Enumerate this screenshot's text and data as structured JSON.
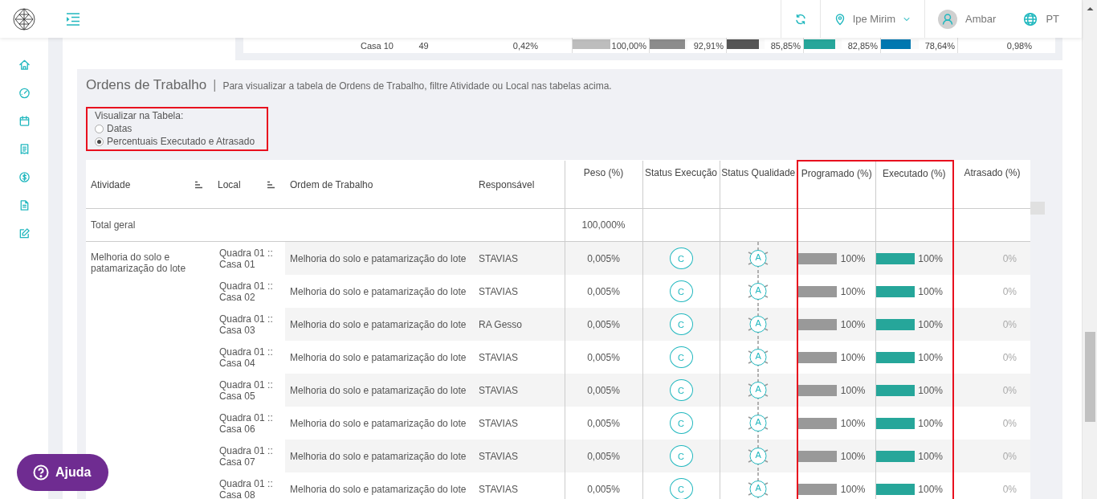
{
  "header": {
    "location": "Ipe Mirim",
    "user": "Ambar",
    "language": "PT"
  },
  "summary_row": {
    "local": "Casa 10",
    "count": "49",
    "share": "0,42%",
    "bars": [
      {
        "value": "100,00%",
        "level": 1,
        "color": "#bdbdbd"
      },
      {
        "value": "92,91%",
        "level": 0.93,
        "color": "#8c8c8c"
      },
      {
        "value": "85,85%",
        "level": 0.86,
        "color": "#555555"
      },
      {
        "value": "82,85%",
        "level": 0.83,
        "color": "#26a69a"
      },
      {
        "value": "78,64%",
        "level": 0.79,
        "color": "#0077b0"
      }
    ],
    "last": "0,98%"
  },
  "section": {
    "title": "Ordens de Trabalho",
    "separator": "|",
    "subtitle": "Para visualizar a tabela de Ordens de Trabalho, filtre Atividade ou Local nas tabelas acima."
  },
  "view_options": {
    "label": "Visualizar na Tabela:",
    "options": [
      {
        "label": "Datas",
        "selected": false
      },
      {
        "label": "Percentuais Executado e Atrasado",
        "selected": true
      }
    ]
  },
  "table": {
    "columns": [
      {
        "label": "Atividade",
        "sortable": true,
        "highlighted": false
      },
      {
        "label": "Local",
        "sortable": true,
        "highlighted": false
      },
      {
        "label": "Ordem de Trabalho",
        "sortable": false,
        "highlighted": false
      },
      {
        "label": "Responsável",
        "sortable": false,
        "highlighted": false
      },
      {
        "label": "Peso (%)",
        "sortable": false,
        "highlighted": false
      },
      {
        "label": "Status Execução",
        "sortable": false,
        "highlighted": false
      },
      {
        "label": "Status Qualidade",
        "sortable": false,
        "highlighted": false
      },
      {
        "label": "Programado (%)",
        "sortable": false,
        "highlighted": true
      },
      {
        "label": "Executado (%)",
        "sortable": false,
        "highlighted": true
      },
      {
        "label": "Atrasado (%)",
        "sortable": false,
        "highlighted": false
      }
    ],
    "total": {
      "label": "Total geral",
      "peso": "100,000%"
    },
    "groups": [
      {
        "activity": "Melhoria do solo e patamarização do lote",
        "rows": [
          {
            "local": "Quadra 01 :: Casa 01",
            "order": "Melhoria do solo e patamarização do lote",
            "responsible": "STAVIAS",
            "peso": "0,005%",
            "execution_status": "C",
            "quality_status": "A",
            "programado": {
              "level": 1,
              "text": "100%"
            },
            "executado": {
              "level": 1,
              "text": "100%"
            },
            "atrasado": "0%"
          },
          {
            "local": "Quadra 01 :: Casa 02",
            "order": "Melhoria do solo e patamarização do lote",
            "responsible": "STAVIAS",
            "peso": "0,005%",
            "execution_status": "C",
            "quality_status": "A",
            "programado": {
              "level": 1,
              "text": "100%"
            },
            "executado": {
              "level": 1,
              "text": "100%"
            },
            "atrasado": "0%"
          },
          {
            "local": "Quadra 01 :: Casa 03",
            "order": "Melhoria do solo e patamarização do lote",
            "responsible": "RA Gesso",
            "peso": "0,005%",
            "execution_status": "C",
            "quality_status": "A",
            "programado": {
              "level": 1,
              "text": "100%"
            },
            "executado": {
              "level": 1,
              "text": "100%"
            },
            "atrasado": "0%"
          },
          {
            "local": "Quadra 01 :: Casa 04",
            "order": "Melhoria do solo e patamarização do lote",
            "responsible": "STAVIAS",
            "peso": "0,005%",
            "execution_status": "C",
            "quality_status": "A",
            "programado": {
              "level": 1,
              "text": "100%"
            },
            "executado": {
              "level": 1,
              "text": "100%"
            },
            "atrasado": "0%"
          },
          {
            "local": "Quadra 01 :: Casa 05",
            "order": "Melhoria do solo e patamarização do lote",
            "responsible": "STAVIAS",
            "peso": "0,005%",
            "execution_status": "C",
            "quality_status": "A",
            "programado": {
              "level": 1,
              "text": "100%"
            },
            "executado": {
              "level": 1,
              "text": "100%"
            },
            "atrasado": "0%"
          },
          {
            "local": "Quadra 01 :: Casa 06",
            "order": "Melhoria do solo e patamarização do lote",
            "responsible": "STAVIAS",
            "peso": "0,005%",
            "execution_status": "C",
            "quality_status": "A",
            "programado": {
              "level": 1,
              "text": "100%"
            },
            "executado": {
              "level": 1,
              "text": "100%"
            },
            "atrasado": "0%"
          },
          {
            "local": "Quadra 01 :: Casa 07",
            "order": "Melhoria do solo e patamarização do lote",
            "responsible": "STAVIAS",
            "peso": "0,005%",
            "execution_status": "C",
            "quality_status": "A",
            "programado": {
              "level": 1,
              "text": "100%"
            },
            "executado": {
              "level": 1,
              "text": "100%"
            },
            "atrasado": "0%"
          },
          {
            "local": "Quadra 01 :: Casa 08",
            "order": "Melhoria do solo e patamarização do lote",
            "responsible": "STAVIAS",
            "peso": "0,005%",
            "execution_status": "C",
            "quality_status": "A",
            "programado": {
              "level": 1,
              "text": "100%"
            },
            "executado": {
              "level": 1,
              "text": "100%"
            },
            "atrasado": "0%"
          }
        ]
      }
    ]
  },
  "help_button": {
    "label": "Ajuda"
  }
}
